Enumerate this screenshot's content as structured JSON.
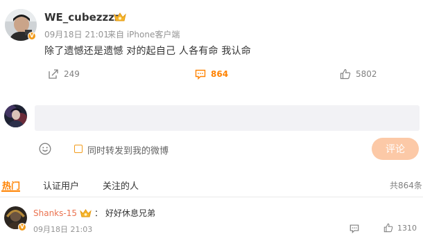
{
  "post": {
    "username": "WE_cubezzzz",
    "time": "09月18日 21:01",
    "source": "来自 iPhone客户端",
    "content": "除了遗憾还是遗憾 对的起自己 人各有命 我认命",
    "verified_badge": "V",
    "actions": {
      "repost_count": "249",
      "comment_count": "864",
      "like_count": "5802"
    },
    "accent_color": "#ff8200"
  },
  "composer": {
    "repost_checkbox_label": "同时转发到我的微博",
    "submit_label": "评论",
    "emoji_icon": "smiley-icon"
  },
  "tabs": {
    "hot": "热门",
    "verified": "认证用户",
    "following": "关注的人",
    "total": "共864条"
  },
  "comments": [
    {
      "username": "Shanks-15",
      "separator": "：",
      "text": "好好休息兄弟",
      "time": "09月18日 21:03",
      "like_count": "1310"
    }
  ]
}
